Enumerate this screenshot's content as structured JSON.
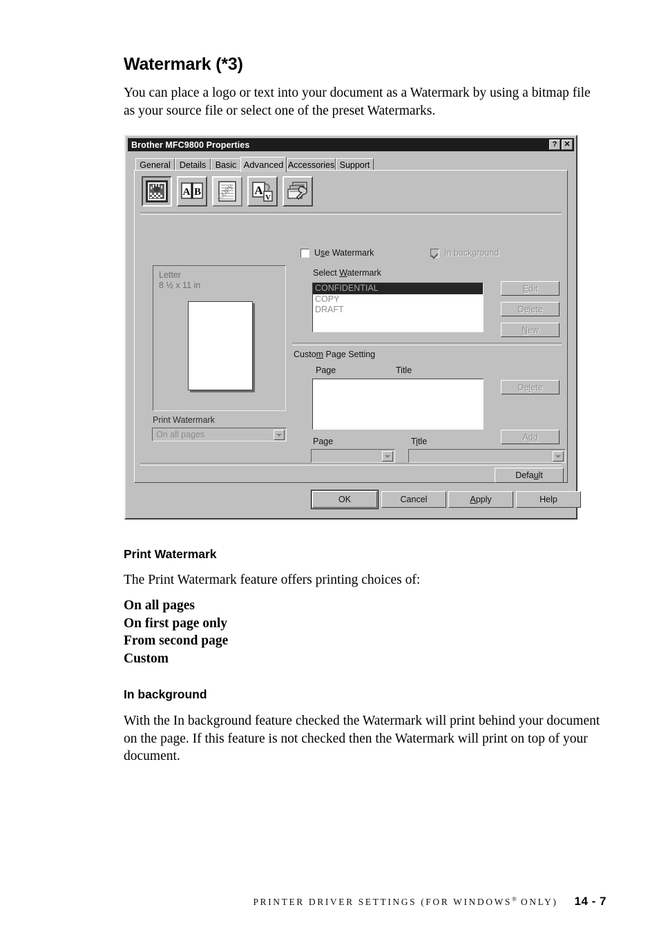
{
  "document": {
    "heading": "Watermark (*3)",
    "intro": "You can place a logo or text into your document as a Watermark by using a bitmap file as your source file or select one of the preset Watermarks.",
    "section1": {
      "title": "Print Watermark",
      "paragraph": "The Print Watermark feature offers printing choices of:",
      "choices": [
        "On all pages",
        "On first page only",
        "From second page",
        "Custom"
      ]
    },
    "section2": {
      "title": "In background",
      "paragraph": "With the In background feature checked the Watermark will print behind your document on the page. If this feature is not checked then the Watermark will print on top of your document."
    },
    "footer": {
      "running_head": "PRINTER DRIVER SETTINGS (FOR WINDOWS",
      "registered_mark": "®",
      "running_head_end": " ONLY)",
      "page_number": "14 - 7"
    }
  },
  "dialog": {
    "title": "Brother MFC9800 Properties",
    "titlebar_buttons": [
      {
        "name": "help-button",
        "glyph": "?"
      },
      {
        "name": "close-button",
        "glyph": "✕"
      }
    ],
    "tabs": [
      {
        "label": "General",
        "selected": false
      },
      {
        "label": "Details",
        "selected": false
      },
      {
        "label": "Basic",
        "selected": false
      },
      {
        "label": "Advanced",
        "selected": true
      },
      {
        "label": "Accessories",
        "selected": false
      },
      {
        "label": "Support",
        "selected": false
      }
    ],
    "toolbar": [
      {
        "name": "print-quality-icon",
        "state": "pressed"
      },
      {
        "name": "duplex-ab-icon",
        "state": "normal",
        "glyph_a": "A",
        "glyph_b": "B"
      },
      {
        "name": "watermark-icon",
        "state": "active",
        "watermark_text": "COPY"
      },
      {
        "name": "page-scaling-icon",
        "state": "normal",
        "glyph_a": "A",
        "glyph_b": "V"
      },
      {
        "name": "device-options-icon",
        "state": "normal"
      }
    ],
    "preview": {
      "paper_name": "Letter",
      "paper_size": "8 ½ x 11 in"
    },
    "print_watermark": {
      "label": "Print Watermark",
      "label_accesskey": "k",
      "value": "On all pages",
      "enabled": false
    },
    "use_watermark": {
      "label": "Use Watermark",
      "checked": false,
      "enabled": true
    },
    "in_background": {
      "label": "In background",
      "checked": true,
      "enabled": false
    },
    "select_watermark": {
      "label": "Select Watermark",
      "items": [
        "CONFIDENTIAL",
        "COPY",
        "DRAFT"
      ],
      "selected_index": 0,
      "buttons": [
        {
          "label": "Edit",
          "enabled": false
        },
        {
          "label": "Delete",
          "enabled": false
        },
        {
          "label": "New",
          "enabled": false
        }
      ]
    },
    "custom_page_setting": {
      "label": "Custom Page Setting",
      "columns": [
        "Page",
        "Title"
      ],
      "rows": [],
      "delete_label": "Delete",
      "delete_enabled": false,
      "add_label": "Add",
      "add_enabled": false,
      "page_field_label": "Page",
      "page_field_value": "",
      "title_field_label": "Title",
      "title_field_value": ""
    },
    "default_button": {
      "label": "Default",
      "enabled": true
    },
    "command_buttons": [
      {
        "label": "OK",
        "focused": true
      },
      {
        "label": "Cancel",
        "focused": false
      },
      {
        "label": "Apply",
        "focused": false
      },
      {
        "label": "Help",
        "focused": false
      }
    ]
  },
  "colors": {
    "dialog_face": "#c0c0c0",
    "titlebar": "#1c1c1c",
    "titlebar_text": "#ffffff",
    "disabled_text": "#8e8e8e",
    "selection": "#252525",
    "paper_white": "#ffffff"
  }
}
